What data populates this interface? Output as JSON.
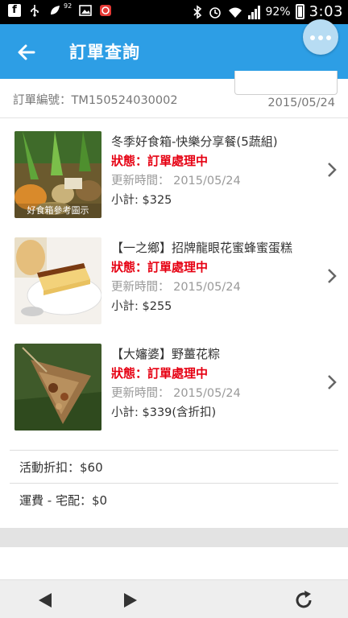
{
  "status_bar": {
    "signal_small": "92",
    "battery_percent": "92%",
    "time": "3:03"
  },
  "app_bar": {
    "title": "訂單查詢"
  },
  "order": {
    "number_label": "訂單編號：TM150524030002",
    "date": "2015/05/24"
  },
  "items": [
    {
      "name": "冬季好食箱-快樂分享餐(5蔬組)",
      "status": "狀態：訂單處理中",
      "updated": "更新時間： 2015/05/24",
      "subtotal": "小計: $325",
      "thumb_caption": "好食箱參考圖示"
    },
    {
      "name": "【一之鄉】招牌龍眼花蜜蜂蜜蛋糕",
      "status": "狀態：訂單處理中",
      "updated": "更新時間： 2015/05/24",
      "subtotal": "小計: $255"
    },
    {
      "name": "【大嬸婆】野薑花粽",
      "status": "狀態：訂單處理中",
      "updated": "更新時間： 2015/05/24",
      "subtotal": "小計: $339(含折扣)"
    }
  ],
  "summary": {
    "discount": "活動折扣：$60",
    "shipping": "運費 - 宅配：$0"
  },
  "colors": {
    "app_bar": "#2d9ee5",
    "status_red": "#e60012",
    "bottom_bar": "#eeeeee"
  },
  "icons": {
    "back": "arrow-left-icon",
    "more": "more-dots-icon",
    "prev": "triangle-left-icon",
    "next": "triangle-right-icon",
    "refresh": "refresh-icon"
  }
}
